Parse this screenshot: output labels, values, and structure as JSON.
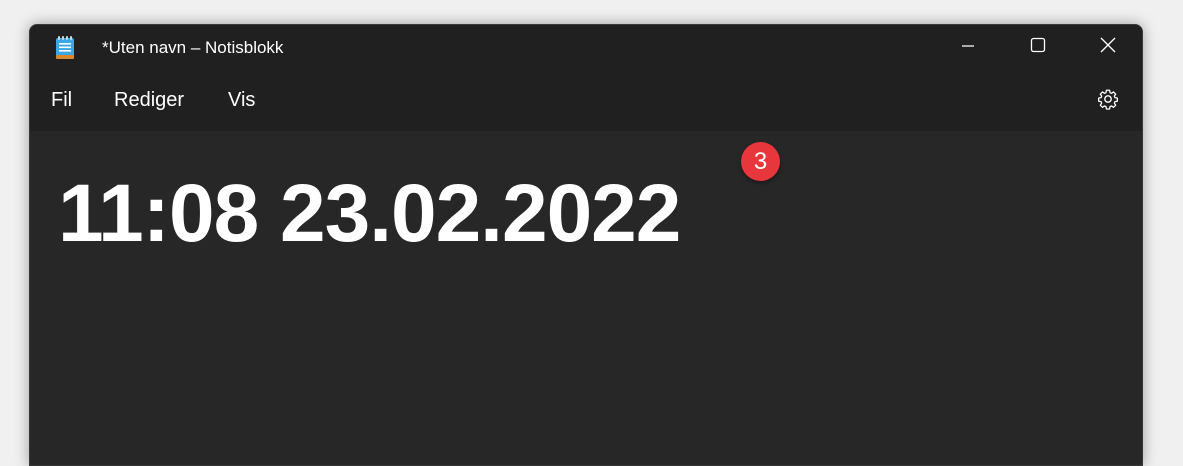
{
  "window": {
    "title": "*Uten navn – Notisblokk",
    "app_icon": "notepad-icon"
  },
  "title_buttons": {
    "minimize_icon": "minimize-icon",
    "maximize_icon": "maximize-icon",
    "close_icon": "close-icon"
  },
  "menu": {
    "items": [
      {
        "label": "Fil"
      },
      {
        "label": "Rediger"
      },
      {
        "label": "Vis"
      }
    ],
    "settings_icon": "gear-icon"
  },
  "editor": {
    "content": "11:08 23.02.2022"
  },
  "annotation": {
    "step_number": "3"
  },
  "colors": {
    "titlebar": "#202020",
    "editor_background": "#272727",
    "text": "#ffffff",
    "badge": "#e8363d"
  }
}
